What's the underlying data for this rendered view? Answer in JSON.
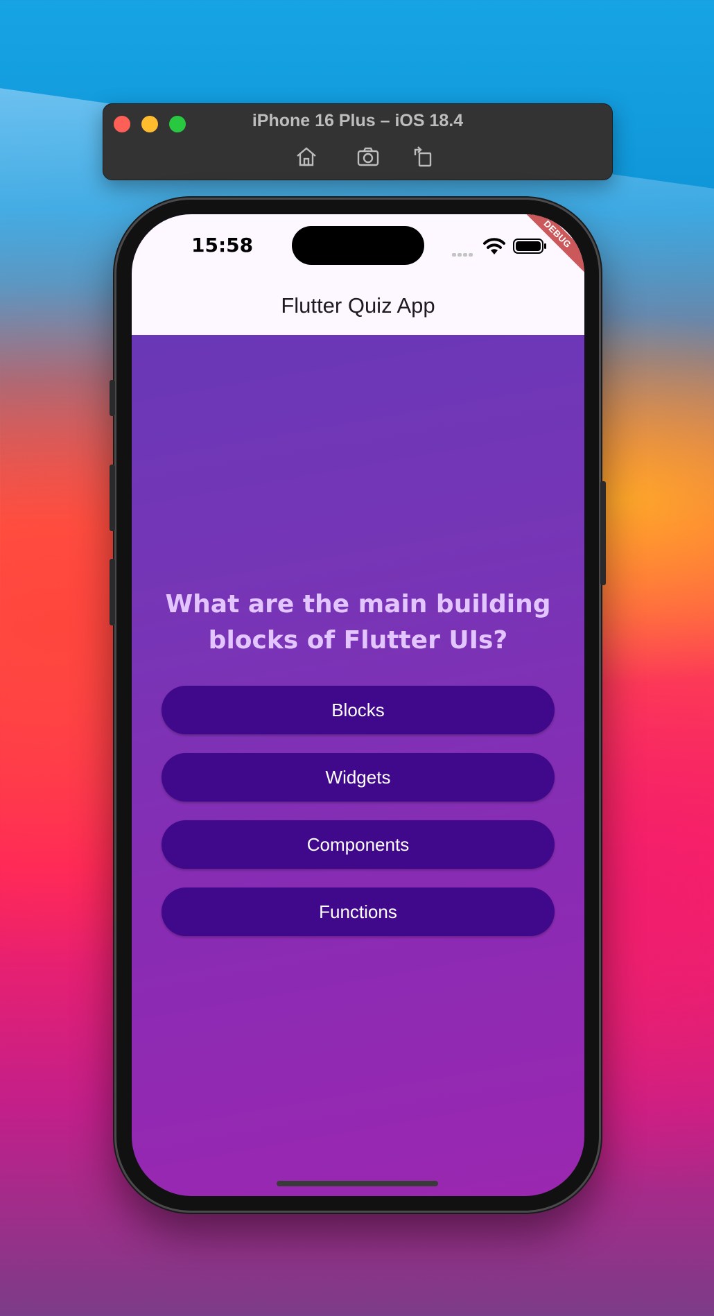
{
  "simulator": {
    "title": "iPhone 16 Plus – iOS 18.4",
    "tools": [
      "home-icon",
      "screenshot-icon",
      "rotate-icon"
    ]
  },
  "status_bar": {
    "time": "15:58",
    "debug_banner": "DEBUG"
  },
  "app_bar": {
    "title": "Flutter Quiz App"
  },
  "quiz": {
    "question": "What are the main building blocks of Flutter UIs?",
    "answers": [
      "Blocks",
      "Widgets",
      "Components",
      "Functions"
    ]
  },
  "colors": {
    "app_bar_bg": "#fdf7ff",
    "gradient_start": "#6438b8",
    "gradient_end": "#9b27b0",
    "question_text": "#e3c6ff",
    "answer_button_bg": "#40088a",
    "answer_button_text": "#ffffff"
  }
}
